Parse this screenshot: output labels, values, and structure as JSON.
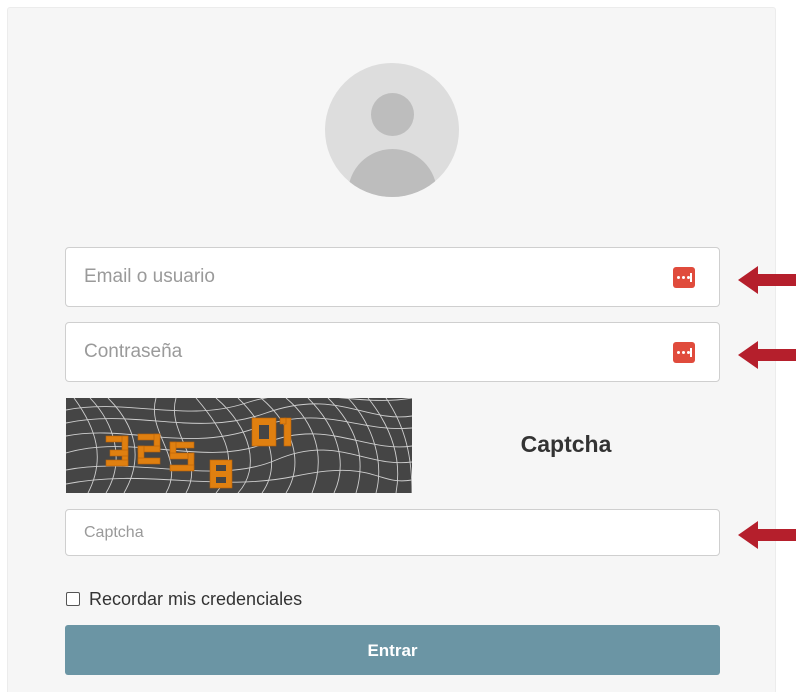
{
  "form": {
    "email_placeholder": "Email o usuario",
    "password_placeholder": "Contraseña",
    "captcha_label": "Captcha",
    "captcha_placeholder": "Captcha",
    "remember_label": "Recordar mis credenciales",
    "submit_label": "Entrar",
    "remember_checked": false
  },
  "captcha_image": {
    "text": "3258 01"
  },
  "colors": {
    "card_background": "#f6f6f6",
    "submit_background": "#6b95a4",
    "password_manager_icon": "#e04b3c",
    "annotation_arrow": "#b51f2c",
    "captcha_digits": "#e08010"
  },
  "icons": {
    "avatar": "user-avatar-icon",
    "password_manager": "password-manager-key-icon",
    "annotation": "left-arrow-icon"
  }
}
